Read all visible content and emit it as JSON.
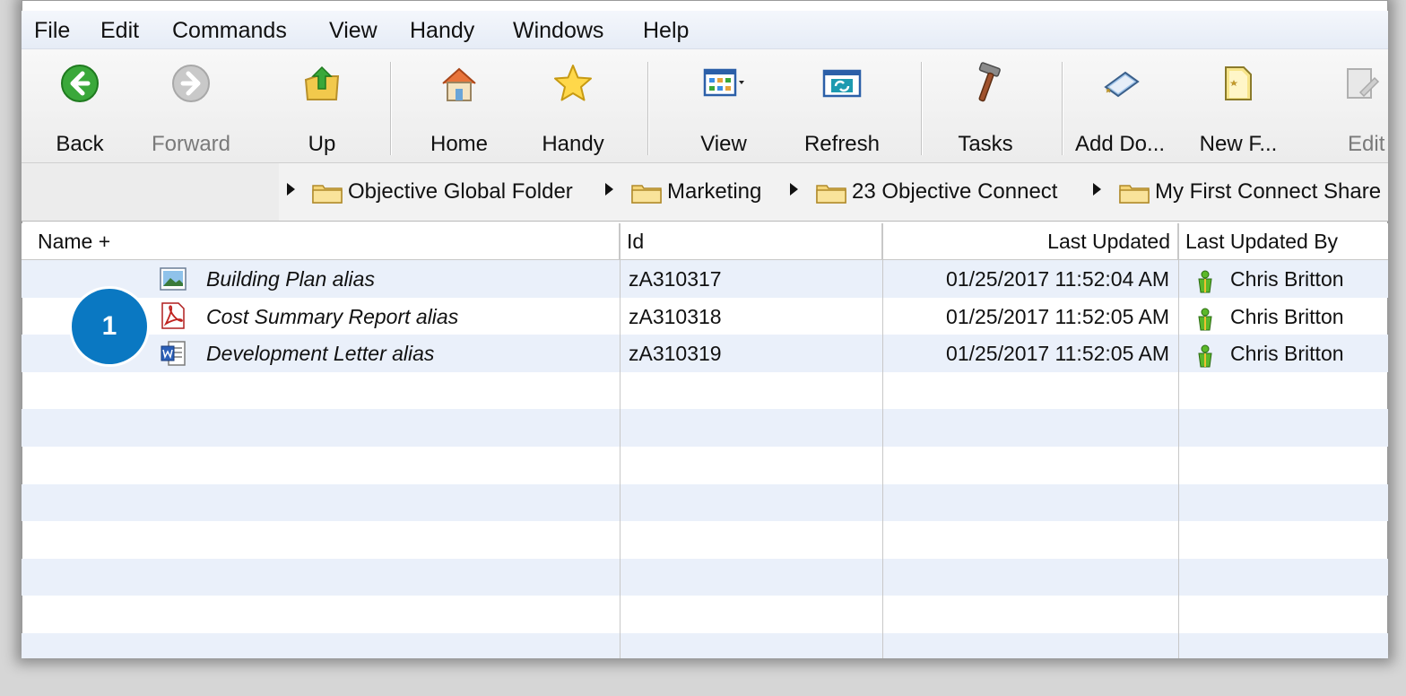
{
  "menu": [
    "File",
    "Edit",
    "Commands",
    "View",
    "Handy",
    "Windows",
    "Help"
  ],
  "toolbar": {
    "back": "Back",
    "forward": "Forward",
    "up": "Up",
    "home": "Home",
    "handy": "Handy",
    "view": "View",
    "refresh": "Refresh",
    "tasks": "Tasks",
    "add_document": "Add Do...",
    "new_folder": "New F...",
    "edit": "Edit"
  },
  "breadcrumb": [
    "Objective Global Folder",
    "Marketing",
    "23 Objective Connect",
    "My First Connect Share"
  ],
  "columns": {
    "name": "Name +",
    "id": "Id",
    "last_updated": "Last Updated",
    "last_updated_by": "Last Updated By"
  },
  "rows": [
    {
      "icon": "image-file-icon",
      "name": "Building Plan alias",
      "id": "zA310317",
      "last_updated": "01/25/2017 11:52:04 AM",
      "last_updated_by": "Chris Britton"
    },
    {
      "icon": "pdf-file-icon",
      "name": "Cost Summary Report alias",
      "id": "zA310318",
      "last_updated": "01/25/2017 11:52:05 AM",
      "last_updated_by": "Chris Britton"
    },
    {
      "icon": "word-file-icon",
      "name": "Development Letter alias",
      "id": "zA310319",
      "last_updated": "01/25/2017 11:52:05 AM",
      "last_updated_by": "Chris Britton"
    }
  ],
  "callout": {
    "number": "1",
    "color": "#0a78c2"
  },
  "colors": {
    "row_alt": "#eaf0fa",
    "accent": "#0a78c2"
  }
}
